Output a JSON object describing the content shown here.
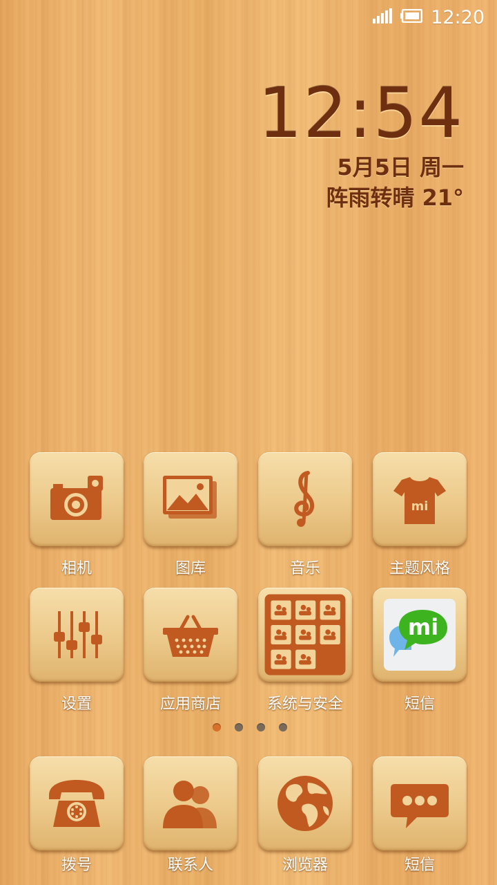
{
  "status_bar": {
    "time": "12:20",
    "signal_icon": "signal-bars-icon",
    "battery_icon": "battery-icon"
  },
  "clock": {
    "time": "12:54",
    "date": "5月5日 周一",
    "weather": "阵雨转晴   21°"
  },
  "apps": [
    {
      "label": "相机",
      "icon": "camera-icon"
    },
    {
      "label": "图库",
      "icon": "gallery-icon"
    },
    {
      "label": "音乐",
      "icon": "treble-clef-icon"
    },
    {
      "label": "主题风格",
      "icon": "tshirt-icon"
    },
    {
      "label": "设置",
      "icon": "sliders-icon"
    },
    {
      "label": "应用商店",
      "icon": "basket-icon"
    },
    {
      "label": "系统与安全",
      "icon": "folder-grid-icon"
    },
    {
      "label": "短信",
      "icon": "mi-chat-icon"
    }
  ],
  "page_indicator": {
    "pages": 4,
    "active": 1
  },
  "dock": [
    {
      "label": "拨号",
      "icon": "phone-icon"
    },
    {
      "label": "联系人",
      "icon": "contacts-icon"
    },
    {
      "label": "浏览器",
      "icon": "globe-icon"
    },
    {
      "label": "短信",
      "icon": "message-bubble-icon"
    }
  ],
  "mi_text": "mi",
  "colors": {
    "engraving": "#c15a20",
    "text_dark": "#6e2e10",
    "active_dot": "#d6712a"
  }
}
